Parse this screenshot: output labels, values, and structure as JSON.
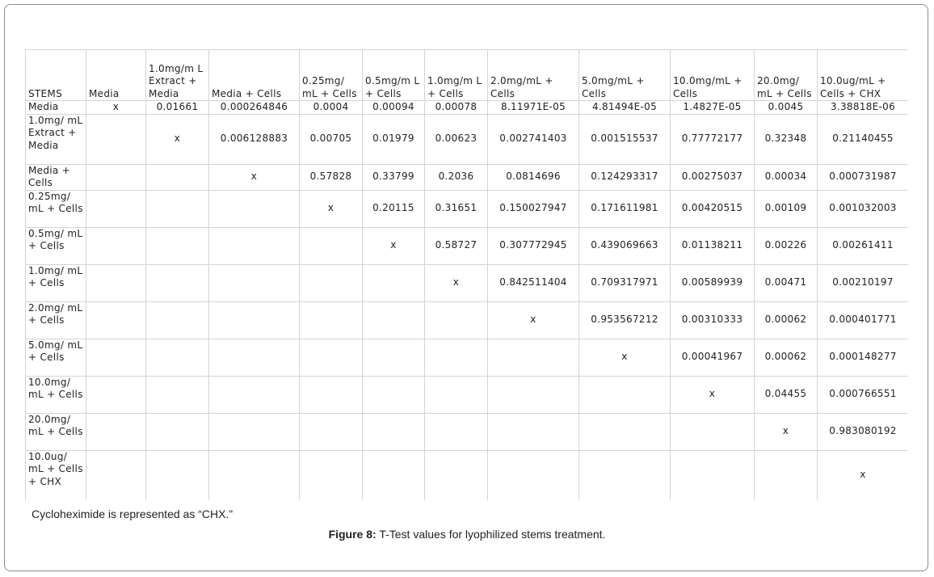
{
  "table": {
    "headers": [
      "STEMS",
      "Media",
      "1.0mg/m L Extract + Media",
      "Media + Cells",
      "0.25mg/ mL + Cells",
      "0.5mg/m L + Cells",
      "1.0mg/m L + Cells",
      "2.0mg/mL + Cells",
      "5.0mg/mL + Cells",
      "10.0mg/mL + Cells",
      "20.0mg/ mL + Cells",
      "10.0ug/mL + Cells + CHX"
    ],
    "rows": [
      [
        "Media",
        "x",
        "0.01661",
        "0.000264846",
        "0.0004",
        "0.00094",
        "0.00078",
        "8.11971E-05",
        "4.81494E-05",
        "1.4827E-05",
        "0.0045",
        "3.38818E-06"
      ],
      [
        "1.0mg/ mL Extract + Media",
        "",
        "x",
        "0.006128883",
        "0.00705",
        "0.01979",
        "0.00623",
        "0.002741403",
        "0.001515537",
        "0.77772177",
        "0.32348",
        "0.21140455"
      ],
      [
        "Media + Cells",
        "",
        "",
        "x",
        "0.57828",
        "0.33799",
        "0.2036",
        "0.0814696",
        "0.124293317",
        "0.00275037",
        "0.00034",
        "0.000731987"
      ],
      [
        "0.25mg/ mL + Cells",
        "",
        "",
        "",
        "x",
        "0.20115",
        "0.31651",
        "0.150027947",
        "0.171611981",
        "0.00420515",
        "0.00109",
        "0.001032003"
      ],
      [
        "0.5mg/ mL + Cells",
        "",
        "",
        "",
        "",
        "x",
        "0.58727",
        "0.307772945",
        "0.439069663",
        "0.01138211",
        "0.00226",
        "0.00261411"
      ],
      [
        "1.0mg/ mL + Cells",
        "",
        "",
        "",
        "",
        "",
        "x",
        "0.842511404",
        "0.709317971",
        "0.00589939",
        "0.00471",
        "0.00210197"
      ],
      [
        "2.0mg/ mL + Cells",
        "",
        "",
        "",
        "",
        "",
        "",
        "x",
        "0.953567212",
        "0.00310333",
        "0.00062",
        "0.000401771"
      ],
      [
        "5.0mg/ mL + Cells",
        "",
        "",
        "",
        "",
        "",
        "",
        "",
        "x",
        "0.00041967",
        "0.00062",
        "0.000148277"
      ],
      [
        "10.0mg/ mL + Cells",
        "",
        "",
        "",
        "",
        "",
        "",
        "",
        "",
        "x",
        "0.04455",
        "0.000766551"
      ],
      [
        "20.0mg/ mL + Cells",
        "",
        "",
        "",
        "",
        "",
        "",
        "",
        "",
        "",
        "x",
        "0.983080192"
      ],
      [
        "10.0ug/ mL + Cells + CHX",
        "",
        "",
        "",
        "",
        "",
        "",
        "",
        "",
        "",
        "",
        "x"
      ]
    ]
  },
  "note": "Cycloheximide is represented as “CHX.”",
  "caption": {
    "label": "Figure 8:",
    "text": "T-Test values for lyophilized stems treatment."
  }
}
